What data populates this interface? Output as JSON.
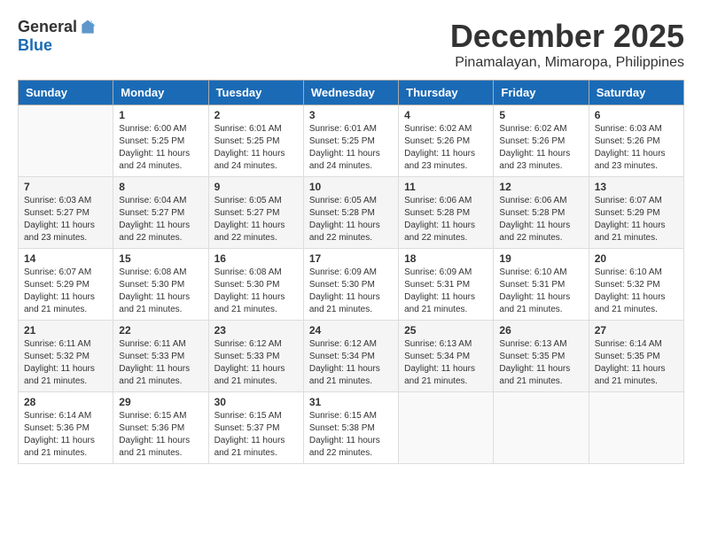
{
  "logo": {
    "general": "General",
    "blue": "Blue"
  },
  "title": {
    "month_year": "December 2025",
    "location": "Pinamalayan, Mimaropa, Philippines"
  },
  "days_header": [
    "Sunday",
    "Monday",
    "Tuesday",
    "Wednesday",
    "Thursday",
    "Friday",
    "Saturday"
  ],
  "weeks": [
    [
      {
        "day": "",
        "sunrise": "",
        "sunset": "",
        "daylight": ""
      },
      {
        "day": "1",
        "sunrise": "Sunrise: 6:00 AM",
        "sunset": "Sunset: 5:25 PM",
        "daylight": "Daylight: 11 hours and 24 minutes."
      },
      {
        "day": "2",
        "sunrise": "Sunrise: 6:01 AM",
        "sunset": "Sunset: 5:25 PM",
        "daylight": "Daylight: 11 hours and 24 minutes."
      },
      {
        "day": "3",
        "sunrise": "Sunrise: 6:01 AM",
        "sunset": "Sunset: 5:25 PM",
        "daylight": "Daylight: 11 hours and 24 minutes."
      },
      {
        "day": "4",
        "sunrise": "Sunrise: 6:02 AM",
        "sunset": "Sunset: 5:26 PM",
        "daylight": "Daylight: 11 hours and 23 minutes."
      },
      {
        "day": "5",
        "sunrise": "Sunrise: 6:02 AM",
        "sunset": "Sunset: 5:26 PM",
        "daylight": "Daylight: 11 hours and 23 minutes."
      },
      {
        "day": "6",
        "sunrise": "Sunrise: 6:03 AM",
        "sunset": "Sunset: 5:26 PM",
        "daylight": "Daylight: 11 hours and 23 minutes."
      }
    ],
    [
      {
        "day": "7",
        "sunrise": "Sunrise: 6:03 AM",
        "sunset": "Sunset: 5:27 PM",
        "daylight": "Daylight: 11 hours and 23 minutes."
      },
      {
        "day": "8",
        "sunrise": "Sunrise: 6:04 AM",
        "sunset": "Sunset: 5:27 PM",
        "daylight": "Daylight: 11 hours and 22 minutes."
      },
      {
        "day": "9",
        "sunrise": "Sunrise: 6:05 AM",
        "sunset": "Sunset: 5:27 PM",
        "daylight": "Daylight: 11 hours and 22 minutes."
      },
      {
        "day": "10",
        "sunrise": "Sunrise: 6:05 AM",
        "sunset": "Sunset: 5:28 PM",
        "daylight": "Daylight: 11 hours and 22 minutes."
      },
      {
        "day": "11",
        "sunrise": "Sunrise: 6:06 AM",
        "sunset": "Sunset: 5:28 PM",
        "daylight": "Daylight: 11 hours and 22 minutes."
      },
      {
        "day": "12",
        "sunrise": "Sunrise: 6:06 AM",
        "sunset": "Sunset: 5:28 PM",
        "daylight": "Daylight: 11 hours and 22 minutes."
      },
      {
        "day": "13",
        "sunrise": "Sunrise: 6:07 AM",
        "sunset": "Sunset: 5:29 PM",
        "daylight": "Daylight: 11 hours and 21 minutes."
      }
    ],
    [
      {
        "day": "14",
        "sunrise": "Sunrise: 6:07 AM",
        "sunset": "Sunset: 5:29 PM",
        "daylight": "Daylight: 11 hours and 21 minutes."
      },
      {
        "day": "15",
        "sunrise": "Sunrise: 6:08 AM",
        "sunset": "Sunset: 5:30 PM",
        "daylight": "Daylight: 11 hours and 21 minutes."
      },
      {
        "day": "16",
        "sunrise": "Sunrise: 6:08 AM",
        "sunset": "Sunset: 5:30 PM",
        "daylight": "Daylight: 11 hours and 21 minutes."
      },
      {
        "day": "17",
        "sunrise": "Sunrise: 6:09 AM",
        "sunset": "Sunset: 5:30 PM",
        "daylight": "Daylight: 11 hours and 21 minutes."
      },
      {
        "day": "18",
        "sunrise": "Sunrise: 6:09 AM",
        "sunset": "Sunset: 5:31 PM",
        "daylight": "Daylight: 11 hours and 21 minutes."
      },
      {
        "day": "19",
        "sunrise": "Sunrise: 6:10 AM",
        "sunset": "Sunset: 5:31 PM",
        "daylight": "Daylight: 11 hours and 21 minutes."
      },
      {
        "day": "20",
        "sunrise": "Sunrise: 6:10 AM",
        "sunset": "Sunset: 5:32 PM",
        "daylight": "Daylight: 11 hours and 21 minutes."
      }
    ],
    [
      {
        "day": "21",
        "sunrise": "Sunrise: 6:11 AM",
        "sunset": "Sunset: 5:32 PM",
        "daylight": "Daylight: 11 hours and 21 minutes."
      },
      {
        "day": "22",
        "sunrise": "Sunrise: 6:11 AM",
        "sunset": "Sunset: 5:33 PM",
        "daylight": "Daylight: 11 hours and 21 minutes."
      },
      {
        "day": "23",
        "sunrise": "Sunrise: 6:12 AM",
        "sunset": "Sunset: 5:33 PM",
        "daylight": "Daylight: 11 hours and 21 minutes."
      },
      {
        "day": "24",
        "sunrise": "Sunrise: 6:12 AM",
        "sunset": "Sunset: 5:34 PM",
        "daylight": "Daylight: 11 hours and 21 minutes."
      },
      {
        "day": "25",
        "sunrise": "Sunrise: 6:13 AM",
        "sunset": "Sunset: 5:34 PM",
        "daylight": "Daylight: 11 hours and 21 minutes."
      },
      {
        "day": "26",
        "sunrise": "Sunrise: 6:13 AM",
        "sunset": "Sunset: 5:35 PM",
        "daylight": "Daylight: 11 hours and 21 minutes."
      },
      {
        "day": "27",
        "sunrise": "Sunrise: 6:14 AM",
        "sunset": "Sunset: 5:35 PM",
        "daylight": "Daylight: 11 hours and 21 minutes."
      }
    ],
    [
      {
        "day": "28",
        "sunrise": "Sunrise: 6:14 AM",
        "sunset": "Sunset: 5:36 PM",
        "daylight": "Daylight: 11 hours and 21 minutes."
      },
      {
        "day": "29",
        "sunrise": "Sunrise: 6:15 AM",
        "sunset": "Sunset: 5:36 PM",
        "daylight": "Daylight: 11 hours and 21 minutes."
      },
      {
        "day": "30",
        "sunrise": "Sunrise: 6:15 AM",
        "sunset": "Sunset: 5:37 PM",
        "daylight": "Daylight: 11 hours and 21 minutes."
      },
      {
        "day": "31",
        "sunrise": "Sunrise: 6:15 AM",
        "sunset": "Sunset: 5:38 PM",
        "daylight": "Daylight: 11 hours and 22 minutes."
      },
      {
        "day": "",
        "sunrise": "",
        "sunset": "",
        "daylight": ""
      },
      {
        "day": "",
        "sunrise": "",
        "sunset": "",
        "daylight": ""
      },
      {
        "day": "",
        "sunrise": "",
        "sunset": "",
        "daylight": ""
      }
    ]
  ]
}
